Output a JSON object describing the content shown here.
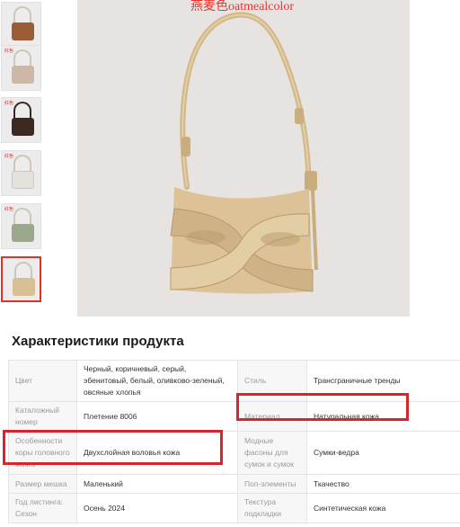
{
  "thumbnails": [
    {
      "color": "#9b5d35",
      "tag": ""
    },
    {
      "color": "#cdb8a6",
      "tag": "红色"
    },
    {
      "color": "#3c2a22",
      "tag": "红色"
    },
    {
      "color": "#e4e1da",
      "tag": "红色"
    },
    {
      "color": "#9aa88e",
      "tag": "红色"
    },
    {
      "color": "#d8c095",
      "tag": "",
      "active": true
    }
  ],
  "main_image": {
    "color_label": "燕麦色oatmealcolor",
    "bag_color": "#d8be92"
  },
  "product_specs": {
    "title": "Характеристики продукта",
    "rows": [
      {
        "k1": "Цвет",
        "v1": "Черный, коричневый, серый, эбенитовый, белый, оливково-зеленый, овсяные хлопья",
        "k2": "Стиль",
        "v2": "Трансграничные тренды"
      },
      {
        "k1": "Каталожный номер",
        "v1": "Плетение 8006",
        "k2": "Материал",
        "v2": "Натуральная кожа"
      },
      {
        "k1": "Особенности коры головного мозга",
        "v1": "Двухслойная воловья кожа",
        "k2": "Модные фасоны для сумок и сумок",
        "v2": "Сумки-ведра"
      },
      {
        "k1": "Размер мешка",
        "v1": "Маленький",
        "k2": "Поп-элементы",
        "v2": "Ткачество"
      },
      {
        "k1": "Год листинга: Сезон",
        "v1": "Осень 2024",
        "k2": "Текстура подкладки",
        "v2": "Синтетическая кожа"
      }
    ]
  },
  "highlight_color": "#d6262d"
}
